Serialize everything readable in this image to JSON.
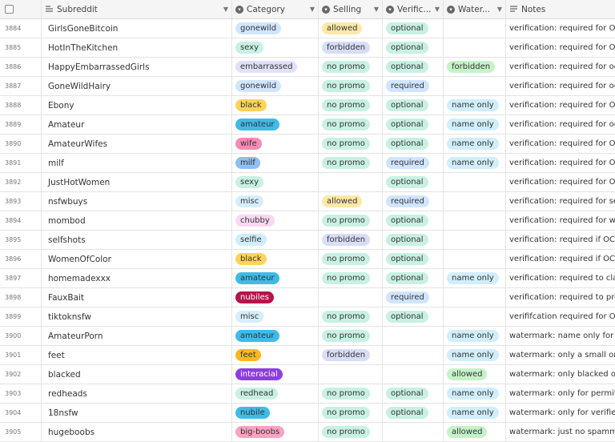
{
  "headers": {
    "subreddit": "Subreddit",
    "category": "Category",
    "selling": "Selling",
    "verification": "Verific...",
    "watermark": "Water...",
    "notes": "Notes"
  },
  "colors": {
    "gonewild": "#d0e5ff",
    "sexy": "#c8f1e3",
    "embarrassed": "#dfe1fb",
    "black": "#fdd45a",
    "amateur": "#3fbbe8",
    "wife": "#f58bb5",
    "milf": "#8fbff4",
    "misc": "#d6eefc",
    "chubby": "#fbd7f1",
    "selfie": "#cfeefb",
    "nubiles": "#b3154a",
    "feet": "#ffb81c",
    "interacial": "#8b3ee0",
    "redhead": "#c8f1e3",
    "nubile": "#3fbbe8",
    "big-boobs": "#f9a3c2",
    "allowed_sell": "#fde8a8",
    "forbidden_sell": "#d8ddf8",
    "no promo": "#c8f1e3",
    "optional": "#c8f1e3",
    "required": "#d0e5ff",
    "name only": "#d0eefb",
    "forbidden_wm": "#c6f2c8",
    "allowed_wm": "#c6f2c8"
  },
  "rows": [
    {
      "id": "3884",
      "sub": "GirlsGoneBitcoin",
      "cat": "gonewild",
      "sell": "allowed",
      "sellc": "allowed_sell",
      "ver": "optional",
      "wm": "",
      "wmc": "",
      "notes": "verification: required for OC"
    },
    {
      "id": "3885",
      "sub": "HotInTheKitchen",
      "cat": "sexy",
      "sell": "forbidden",
      "sellc": "forbidden_sell",
      "ver": "optional",
      "wm": "",
      "wmc": "",
      "notes": "verification: required for OC"
    },
    {
      "id": "3886",
      "sub": "HappyEmbarrassedGirls",
      "cat": "embarrassed",
      "sell": "no promo",
      "sellc": "no promo",
      "ver": "optional",
      "wm": "forbidden",
      "wmc": "forbidden_wm",
      "notes": "verification: required for oc"
    },
    {
      "id": "3887",
      "sub": "GoneWildHairy",
      "cat": "gonewild",
      "sell": "no promo",
      "sellc": "no promo",
      "ver": "required",
      "wm": "",
      "wmc": "",
      "notes": "verification: required for oc"
    },
    {
      "id": "3888",
      "sub": "Ebony",
      "cat": "black",
      "sell": "no promo",
      "sellc": "no promo",
      "ver": "optional",
      "wm": "name only",
      "wmc": "name only",
      "notes": "verification: required for OC,"
    },
    {
      "id": "3889",
      "sub": "Amateur",
      "cat": "amateur",
      "sell": "no promo",
      "sellc": "no promo",
      "ver": "optional",
      "wm": "name only",
      "wmc": "name only",
      "notes": "verification: required for oc..."
    },
    {
      "id": "3890",
      "sub": "AmateurWifes",
      "cat": "wife",
      "sell": "no promo",
      "sellc": "no promo",
      "ver": "optional",
      "wm": "name only",
      "wmc": "name only",
      "notes": "verification: required for O..."
    },
    {
      "id": "3891",
      "sub": "milf",
      "cat": "milf",
      "sell": "no promo",
      "sellc": "no promo",
      "ver": "required",
      "wm": "name only",
      "wmc": "name only",
      "notes": "verification: required for O..."
    },
    {
      "id": "3892",
      "sub": "JustHotWomen",
      "cat": "sexy",
      "sell": "",
      "sellc": "",
      "ver": "optional",
      "wm": "",
      "wmc": "",
      "notes": "verification: required for O..."
    },
    {
      "id": "3893",
      "sub": "nsfwbuys",
      "cat": "misc",
      "sell": "allowed",
      "sellc": "allowed_sell",
      "ver": "required",
      "wm": "",
      "wmc": "",
      "notes": "verification: required for sel..."
    },
    {
      "id": "3894",
      "sub": "mombod",
      "cat": "chubby",
      "sell": "no promo",
      "sellc": "no promo",
      "ver": "optional",
      "wm": "",
      "wmc": "",
      "notes": "verification: required for wi..."
    },
    {
      "id": "3895",
      "sub": "selfshots",
      "cat": "selfie",
      "sell": "forbidden",
      "sellc": "forbidden_sell",
      "ver": "optional",
      "wm": "",
      "wmc": "",
      "notes": "verification: required if OC"
    },
    {
      "id": "3896",
      "sub": "WomenOfColor",
      "cat": "black",
      "sell": "no promo",
      "sellc": "no promo",
      "ver": "optional",
      "wm": "",
      "wmc": "",
      "notes": "verification: required if OC"
    },
    {
      "id": "3897",
      "sub": "homemadexxx",
      "cat": "amateur",
      "sell": "no promo",
      "sellc": "no promo",
      "ver": "optional",
      "wm": "name only",
      "wmc": "name only",
      "notes": "verification: required to clai..."
    },
    {
      "id": "3898",
      "sub": "FauxBait",
      "cat": "nubiles",
      "sell": "",
      "sellc": "",
      "ver": "required",
      "wm": "",
      "wmc": "",
      "notes": "verification: required to pro..."
    },
    {
      "id": "3899",
      "sub": "tiktoknsfw",
      "cat": "misc",
      "sell": "no promo",
      "sellc": "no promo",
      "ver": "optional",
      "wm": "",
      "wmc": "",
      "notes": "verififcation required for OC"
    },
    {
      "id": "3900",
      "sub": "AmateurPorn",
      "cat": "amateur",
      "sell": "no promo",
      "sellc": "no promo",
      "ver": "",
      "wm": "name only",
      "wmc": "name only",
      "notes": "watermark: name only for ..."
    },
    {
      "id": "3901",
      "sub": "feet",
      "cat": "feet",
      "sell": "forbidden",
      "sellc": "forbidden_sell",
      "ver": "",
      "wm": "name only",
      "wmc": "name only",
      "notes": "watermark: only a small on..."
    },
    {
      "id": "3902",
      "sub": "blacked",
      "cat": "interacial",
      "sell": "",
      "sellc": "",
      "ver": "",
      "wm": "allowed",
      "wmc": "allowed_wm",
      "notes": "watermark: only blacked or..."
    },
    {
      "id": "3903",
      "sub": "redheads",
      "cat": "redhead",
      "sell": "no promo",
      "sellc": "no promo",
      "ver": "optional",
      "wm": "name only",
      "wmc": "name only",
      "notes": "watermark: only for permitt..."
    },
    {
      "id": "3904",
      "sub": "18nsfw",
      "cat": "nubile",
      "sell": "no promo",
      "sellc": "no promo",
      "ver": "optional",
      "wm": "name only",
      "wmc": "name only",
      "notes": "watermark: only for verified..."
    },
    {
      "id": "3905",
      "sub": "hugeboobs",
      "cat": "big-boobs",
      "sell": "no promo",
      "sellc": "no promo",
      "ver": "",
      "wm": "allowed",
      "wmc": "allowed_wm",
      "notes": "watermark: just no spamm..."
    }
  ]
}
